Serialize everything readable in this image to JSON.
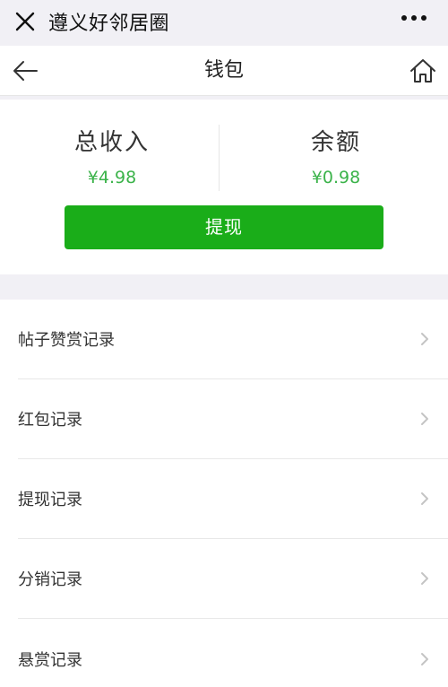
{
  "wechat_bar": {
    "title": "遵义好邻居圈",
    "close_icon": "close-icon",
    "more_icon": "more-dots-icon"
  },
  "header": {
    "title": "钱包",
    "back_icon": "back-arrow-icon",
    "home_icon": "home-icon"
  },
  "wallet": {
    "total_income_label": "总收入",
    "total_income_value": "¥4.98",
    "balance_label": "余额",
    "balance_value": "¥0.98",
    "withdraw_button": "提现",
    "accent_color": "#3bb34a",
    "button_color": "#1aad19"
  },
  "records": [
    {
      "label": "帖子赞赏记录"
    },
    {
      "label": "红包记录"
    },
    {
      "label": "提现记录"
    },
    {
      "label": "分销记录"
    },
    {
      "label": "悬赏记录"
    }
  ]
}
